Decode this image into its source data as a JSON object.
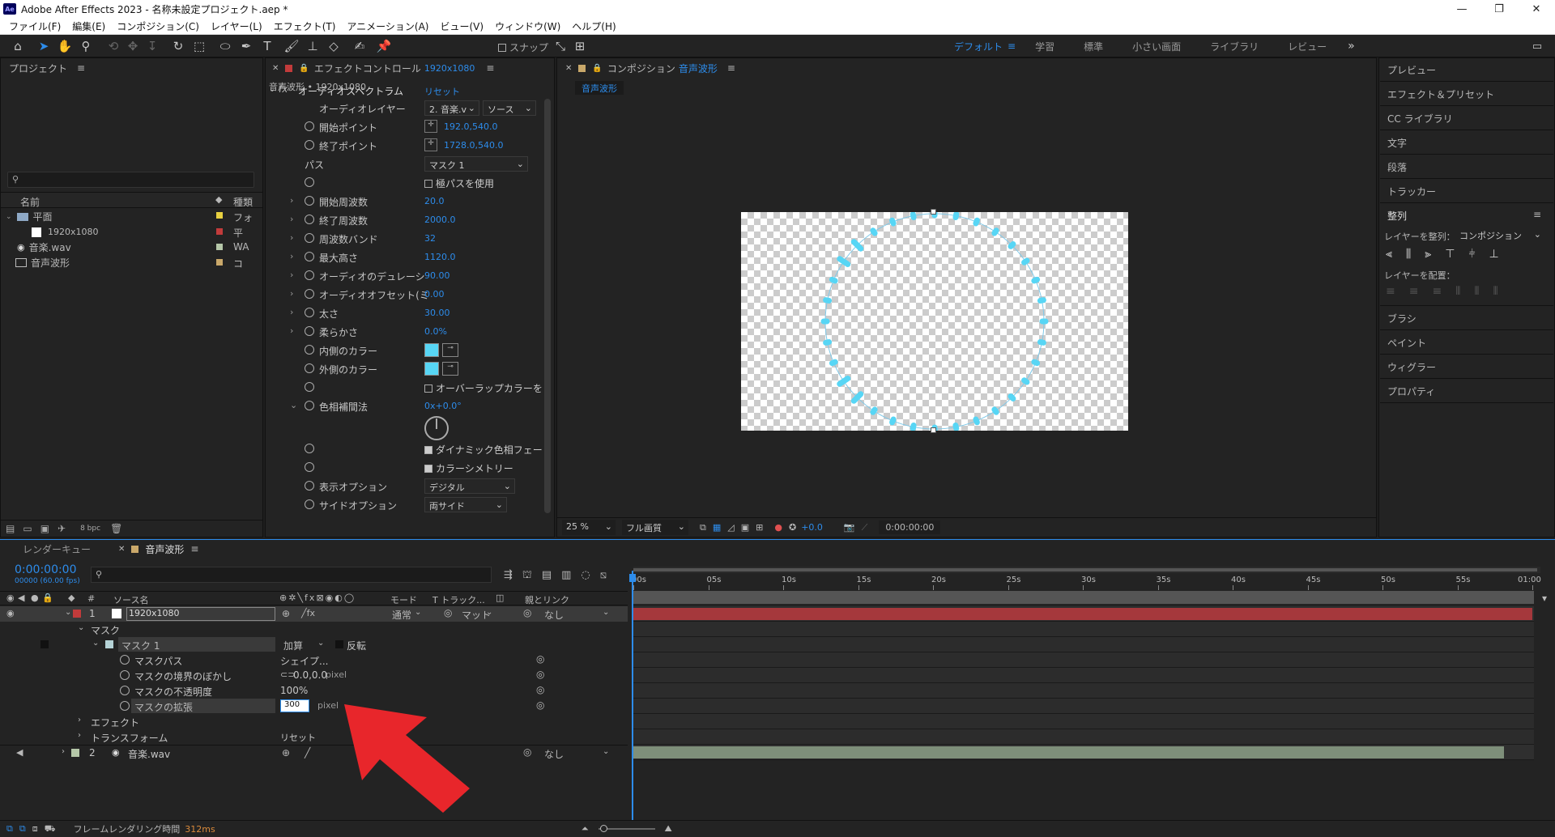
{
  "window": {
    "title": "Adobe After Effects 2023 - 名称未設定プロジェクト.aep *",
    "app_icon": "Ae",
    "minimize": "—",
    "maximize": "❐",
    "close": "✕"
  },
  "menu": [
    "ファイル(F)",
    "編集(E)",
    "コンポジション(C)",
    "レイヤー(L)",
    "エフェクト(T)",
    "アニメーション(A)",
    "ビュー(V)",
    "ウィンドウ(W)",
    "ヘルプ(H)"
  ],
  "toolbar": {
    "snap_label": "スナップ",
    "workspaces": [
      "デフォルト",
      "学習",
      "標準",
      "小さい画面",
      "ライブラリ",
      "レビュー"
    ],
    "active_workspace": "デフォルト"
  },
  "project": {
    "title": "プロジェクト",
    "col_name": "名前",
    "col_type": "種類",
    "items": [
      {
        "name": "平面",
        "type": "フォ",
        "swatch": "#e8d040",
        "icon": "folder-icon"
      },
      {
        "name": "1920x1080",
        "type": "平",
        "swatch": "#c23b3b",
        "icon": "solid-icon"
      },
      {
        "name": "音楽.wav",
        "type": "WA",
        "swatch": "#b5c7a8",
        "icon": "audio-icon"
      },
      {
        "name": "音声波形",
        "type": "コ",
        "swatch": "#c9a86a",
        "icon": "composition-icon"
      }
    ],
    "bpc": "8 bpc"
  },
  "effects": {
    "tab_title": "エフェクトコントロール",
    "tab_layer": "1920x1080",
    "subtitle": "音声波形 • 1920x1080",
    "effect_name": "オーディオスペクトラム",
    "reset": "リセット",
    "audio_layer_label": "オーディオレイヤー",
    "audio_layer_value": "2. 音楽.v",
    "audio_source": "ソース",
    "start_point_label": "開始ポイント",
    "start_point": "192.0,540.0",
    "end_point_label": "終了ポイント",
    "end_point": "1728.0,540.0",
    "path_label": "パス",
    "path_value": "マスク 1",
    "polar_label": "極パスを使用",
    "start_freq_label": "開始周波数",
    "start_freq": "20.0",
    "end_freq_label": "終了周波数",
    "end_freq": "2000.0",
    "bands_label": "周波数バンド",
    "bands": "32",
    "max_height_label": "最大高さ",
    "max_height": "1120.0",
    "duration_label": "オーディオのデュレーシ",
    "duration": "90.00",
    "offset_label": "オーディオオフセット(ミ",
    "offset": "0.00",
    "thickness_label": "太さ",
    "thickness": "30.00",
    "softness_label": "柔らかさ",
    "softness": "0.0%",
    "inside_color_label": "内側のカラー",
    "inside_color": "#57d6f5",
    "outside_color_label": "外側のカラー",
    "outside_color": "#57d6f5",
    "overlap_label": "オーバーラップカラーを",
    "hue_interp_label": "色相補間法",
    "hue_interp": "0x+0.0°",
    "dynamic_hue_label": "ダイナミック色相フェー",
    "color_sym_label": "カラーシメトリー",
    "display_label": "表示オプション",
    "display_value": "デジタル",
    "side_label": "サイドオプション",
    "side_value": "両サイド"
  },
  "composition": {
    "tab_label": "コンポジション",
    "tab_name": "音声波形",
    "breadcrumb": "音声波形",
    "zoom": "25 %",
    "quality": "フル画質",
    "exposure": "+0.0",
    "timecode": "0:00:00:00",
    "waveform_color": "#57d6f5"
  },
  "right_panels": {
    "items": [
      "プレビュー",
      "エフェクト＆プリセット",
      "CC ライブラリ",
      "文字",
      "段落",
      "トラッカー"
    ],
    "align_title": "整列",
    "align_to_label": "レイヤーを整列：",
    "align_to_value": "コンポジション",
    "distribute_label": "レイヤーを配置：",
    "items2": [
      "ブラシ",
      "ペイント",
      "ウィグラー",
      "プロパティ"
    ]
  },
  "timeline": {
    "render_queue": "レンダーキュー",
    "comp_tab": "音声波形",
    "timecode": "0:00:00:00",
    "fps": "00000 (60.00 fps)",
    "col_hash": "#",
    "col_source": "ソース名",
    "col_mode": "モード",
    "col_track": "T トラック...",
    "col_parent": "親とリンク",
    "ruler": [
      "00s",
      "05s",
      "10s",
      "15s",
      "20s",
      "25s",
      "30s",
      "35s",
      "40s",
      "45s",
      "50s",
      "55s",
      "01:00"
    ],
    "layer1": {
      "num": "1",
      "name": "1920x1080",
      "mode": "通常",
      "track": "マット",
      "parent": "なし",
      "color": "#c23b3b"
    },
    "mask_group": "マスク",
    "mask1": {
      "name": "マスク 1",
      "mode": "加算",
      "invert": "反転"
    },
    "mask_path": {
      "label": "マスクパス",
      "value": "シェイプ..."
    },
    "mask_feather": {
      "label": "マスクの境界のぼかし",
      "value": "0.0,0.0",
      "unit": "pixel"
    },
    "mask_opacity": {
      "label": "マスクの不透明度",
      "value": "100%"
    },
    "mask_expansion": {
      "label": "マスクの拡張",
      "value": "300",
      "unit": "pixel"
    },
    "effects_group": "エフェクト",
    "transform_group": "トランスフォーム",
    "transform_reset": "リセット",
    "layer2": {
      "num": "2",
      "name": "音楽.wav",
      "parent": "なし",
      "color": "#b5c7a8"
    },
    "render_time_label": "フレームレンダリング時間",
    "render_time": "312ms"
  },
  "annotation": {
    "arrow_color": "#e8262b"
  }
}
